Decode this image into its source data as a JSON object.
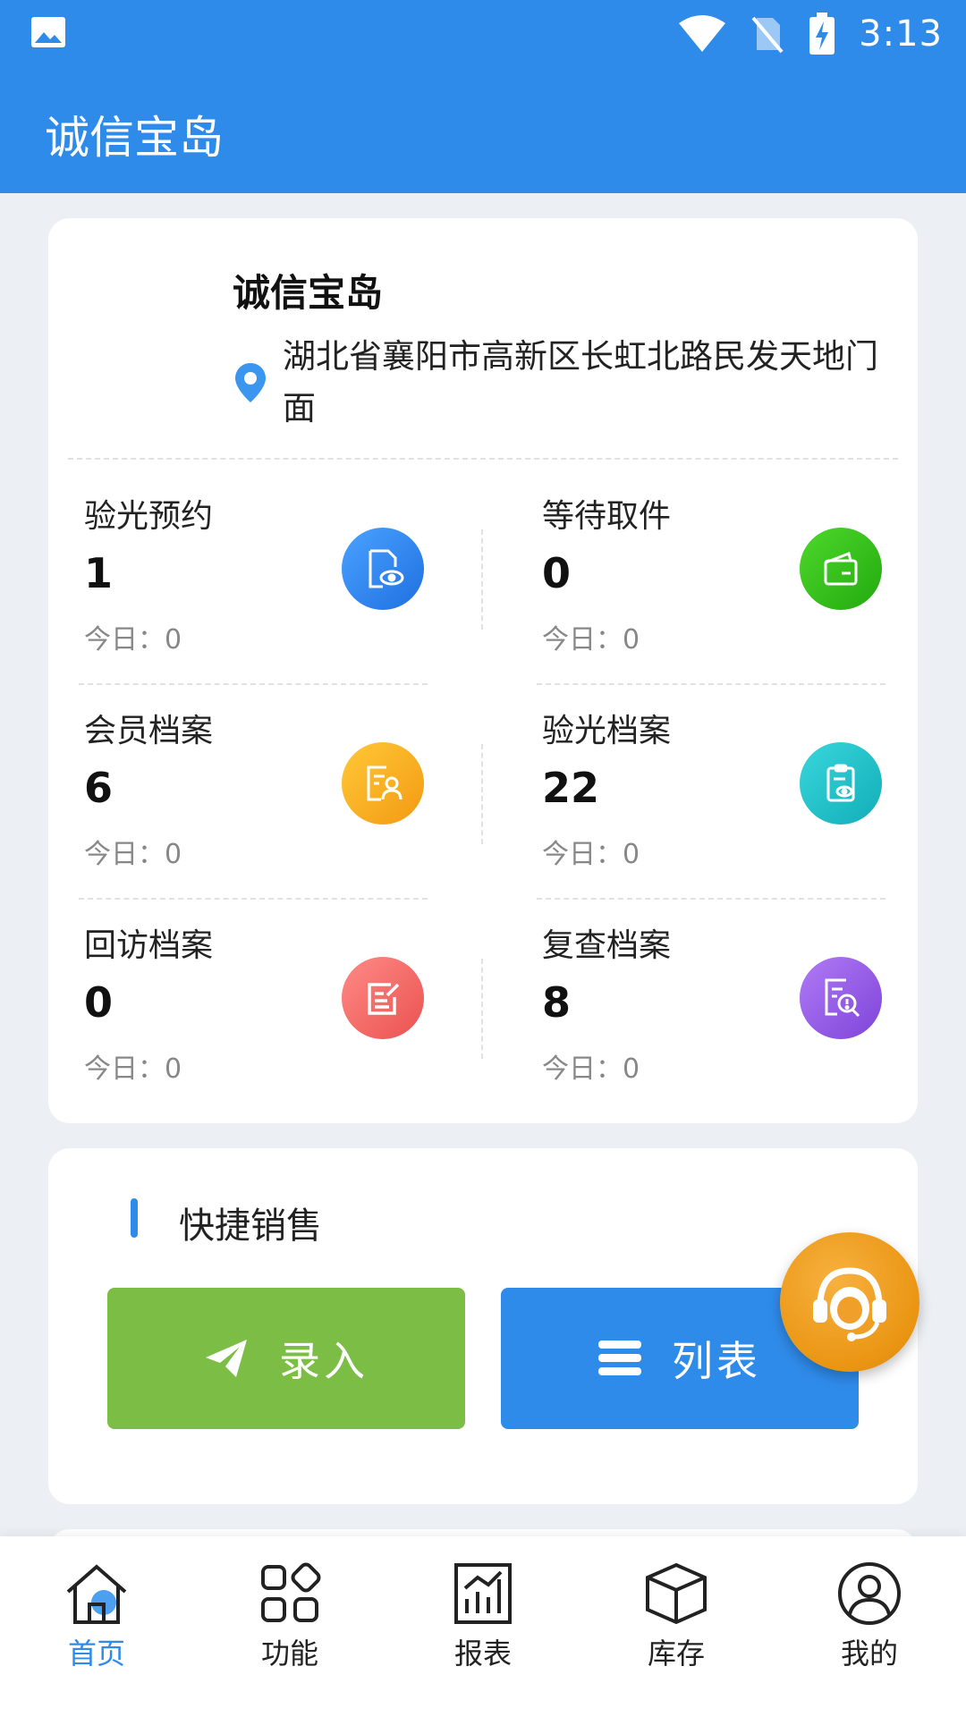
{
  "status_bar": {
    "time": "3:13"
  },
  "app_bar": {
    "title": "诚信宝岛"
  },
  "shop": {
    "name": "诚信宝岛",
    "address": "湖北省襄阳市高新区长虹北路民发天地门面"
  },
  "stats": [
    {
      "label": "验光预约",
      "value": "1",
      "today": "今日：0",
      "icon": "eye-document-icon",
      "color": "#2d83f0"
    },
    {
      "label": "等待取件",
      "value": "0",
      "today": "今日：0",
      "icon": "wallet-icon",
      "color": "#33c21a"
    },
    {
      "label": "会员档案",
      "value": "6",
      "today": "今日：0",
      "icon": "member-file-icon",
      "color": "#f7b21d"
    },
    {
      "label": "验光档案",
      "value": "22",
      "today": "今日：0",
      "icon": "clipboard-eye-icon",
      "color": "#1bc4cc"
    },
    {
      "label": "回访档案",
      "value": "0",
      "today": "今日：0",
      "icon": "edit-note-icon",
      "color": "#f26a6a"
    },
    {
      "label": "复查档案",
      "value": "8",
      "today": "今日：0",
      "icon": "search-document-icon",
      "color": "#9a5ee6"
    }
  ],
  "quick_sales": {
    "title": "快捷销售",
    "entry_label": "录入",
    "list_label": "列表"
  },
  "tabs": [
    {
      "label": "首页",
      "icon": "home-icon",
      "active": true
    },
    {
      "label": "功能",
      "icon": "grid-icon"
    },
    {
      "label": "报表",
      "icon": "report-chart-icon"
    },
    {
      "label": "库存",
      "icon": "box-icon"
    },
    {
      "label": "我的",
      "icon": "user-icon"
    }
  ],
  "colors": {
    "primary": "#2f8bea",
    "green": "#7cbd45",
    "fab": "#ea9513"
  }
}
